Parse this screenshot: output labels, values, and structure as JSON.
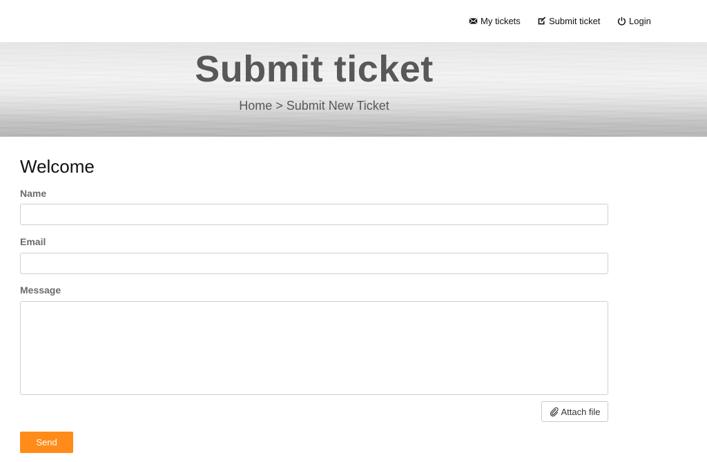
{
  "nav": {
    "items": [
      {
        "label": "My tickets",
        "icon": "envelope-icon"
      },
      {
        "label": "Submit ticket",
        "icon": "edit-icon"
      },
      {
        "label": "Login",
        "icon": "power-icon"
      }
    ]
  },
  "hero": {
    "title": "Submit ticket",
    "breadcrumb": "Home > Submit New Ticket"
  },
  "form": {
    "heading": "Welcome",
    "name_label": "Name",
    "name_value": "",
    "email_label": "Email",
    "email_value": "",
    "message_label": "Message",
    "message_value": "",
    "attach_label": "Attach file",
    "attach_icon": "paperclip-icon",
    "send_label": "Send"
  },
  "colors": {
    "accent": "#ff8c1a",
    "label_text": "#6a6a6a",
    "hero_text": "#585858"
  }
}
